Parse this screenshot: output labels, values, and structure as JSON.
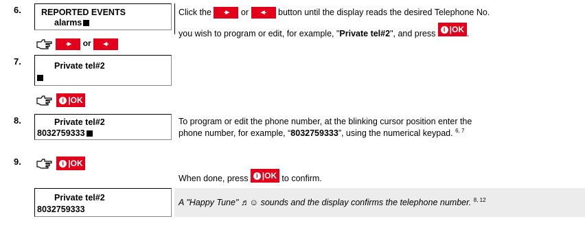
{
  "steps": {
    "s6": {
      "number": "6.",
      "lcd_line1": "REPORTED EVENTS",
      "lcd_line2": "alarms",
      "text_before": "Click the",
      "text_or": "or",
      "text_after": "button until the display reads the desired Telephone No.",
      "text2_before": "you wish to program or edit, for example, \"",
      "text2_bold": "Private tel#2",
      "text2_after": "\", and press",
      "text2_end": ".",
      "hint_or": "or"
    },
    "s7": {
      "number": "7.",
      "lcd_line1": "Private tel#2"
    },
    "s8": {
      "number": "8.",
      "lcd_line1": "Private tel#2",
      "lcd_line2": "8032759333",
      "text1": "To program or edit the phone number, at the blinking cursor position enter the",
      "text2_before": "phone number, for example, “",
      "text2_bold": "8032759333",
      "text2_after": "”, using the numerical keypad.",
      "text2_sup": "6, 7"
    },
    "s9": {
      "number": "9.",
      "text_before": "When done, press",
      "text_after": "to confirm.",
      "lcd_line1": "Private tel#2",
      "lcd_line2": "8032759333",
      "note": "A \"Happy Tune\" ♬☺ sounds and the display confirms the telephone number.",
      "note_sup": "8, 12"
    }
  },
  "keys": {
    "next_label": "-▸",
    "prev_label": "◂-",
    "ok_icon": "❰",
    "ok_label": "|OK"
  },
  "icons": {
    "hand": "pointing-hand-icon",
    "key_color": "#e2001a"
  }
}
